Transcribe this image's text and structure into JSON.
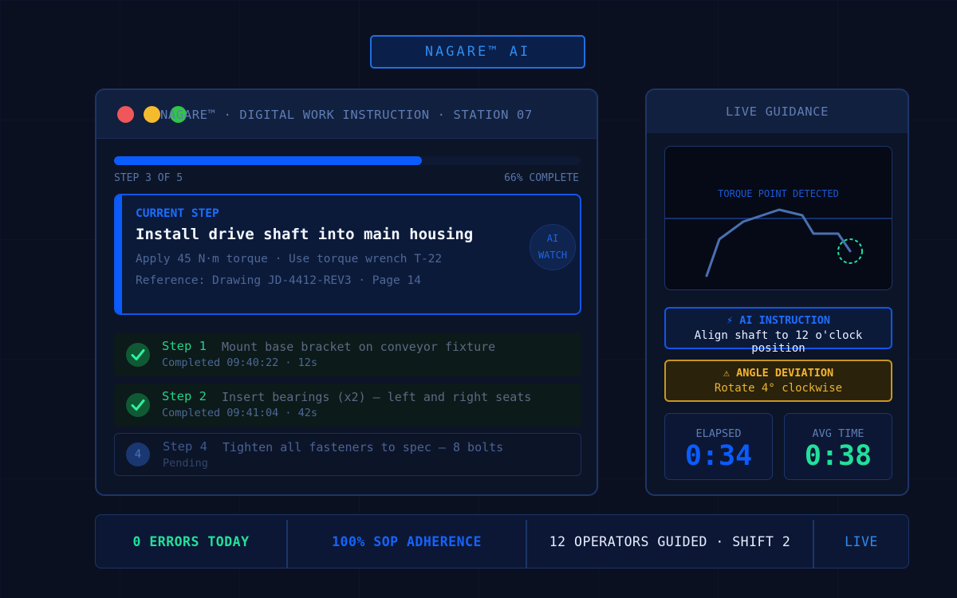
{
  "brand": {
    "label": "NAGARE™ AI"
  },
  "window": {
    "title": "NAGARE™ · DIGITAL WORK INSTRUCTION · STATION 07"
  },
  "progress": {
    "step_text": "STEP 3 OF 5",
    "percent_text": "66% COMPLETE",
    "fraction": 0.66
  },
  "current_step": {
    "label": "CURRENT STEP",
    "title": "Install drive shaft into main housing",
    "line1": "Apply 45 N·m torque · Use torque wrench T-22",
    "line2": "Reference: Drawing JD-4412-REV3 · Page 14",
    "ai_watch_line1": "AI",
    "ai_watch_line2": "WATCH"
  },
  "steps": [
    {
      "name": "Step 1",
      "desc": "Mount base bracket on conveyor fixture",
      "status": "Completed 09:40:22 · 12s",
      "state": "done"
    },
    {
      "name": "Step 2",
      "desc": "Insert bearings (x2) — left and right seats",
      "status": "Completed 09:41:04 · 42s",
      "state": "done"
    },
    {
      "name": "Step 4",
      "desc": "Tighten all fasteners to spec — 8 bolts",
      "status": "Pending",
      "state": "pending",
      "number": "4"
    }
  ],
  "side": {
    "header": "LIVE GUIDANCE",
    "camera_label": "TORQUE POINT DETECTED",
    "ai_instruction_title": "⚡ AI INSTRUCTION",
    "ai_instruction_text": "Align shaft to 12 o'clock position",
    "angle_title": "⚠ ANGLE DEVIATION",
    "angle_text": "Rotate 4° clockwise",
    "elapsed_label": "ELAPSED",
    "elapsed_value": "0:34",
    "avg_label": "AVG TIME",
    "avg_value": "0:38"
  },
  "bottom": {
    "errors": "0 ERRORS TODAY",
    "adherence": "100% SOP ADHERENCE",
    "operators": "12 OPERATORS GUIDED · SHIFT 2",
    "live": "LIVE"
  },
  "colors": {
    "accent_blue": "#0a5cff",
    "success_green": "#22d389",
    "warning_amber": "#f4b431",
    "background": "#0b1020"
  },
  "icons": {
    "check": "check-icon",
    "bolt": "bolt-icon",
    "warning": "warning-icon"
  }
}
